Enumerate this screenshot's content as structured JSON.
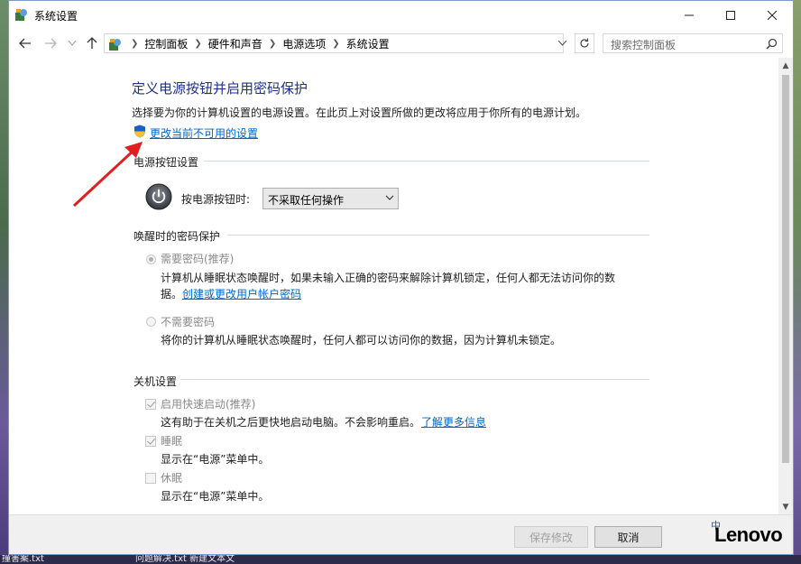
{
  "window": {
    "title": "系统设置"
  },
  "nav": {
    "breadcrumbs": [
      "控制面板",
      "硬件和声音",
      "电源选项",
      "系统设置"
    ],
    "search_placeholder": "搜索控制面板"
  },
  "page": {
    "title": "定义电源按钮并启用密码保护",
    "description": "选择要为你的计算机设置的电源设置。在此页上对设置所做的更改将应用于你所有的电源计划。",
    "change_link": "更改当前不可用的设置"
  },
  "power_button": {
    "section_title": "电源按钮设置",
    "label": "按电源按钮时:",
    "selected": "不采取任何操作"
  },
  "wake_password": {
    "section_title": "唤醒时的密码保护",
    "require": {
      "label": "需要密码(推荐)",
      "desc_line1": "计算机从睡眠状态唤醒时，如果未输入正确的密码来解除计算机锁定，任何人都无法访问你的数",
      "desc_line2_prefix": "据。",
      "link": "创建或更改用户帐户密码",
      "checked": true
    },
    "no_require": {
      "label": "不需要密码",
      "desc": "将你的计算机从睡眠状态唤醒时，任何人都可以访问你的数据，因为计算机未锁定。",
      "checked": false
    }
  },
  "shutdown": {
    "section_title": "关机设置",
    "fast_startup": {
      "label": "启用快速启动(推荐)",
      "desc": "这有助于在关机之后更快地启动电脑。不会影响重启。",
      "link": "了解更多信息",
      "checked": true
    },
    "sleep": {
      "label": "睡眠",
      "desc": "显示在“电源”菜单中。",
      "checked": true
    },
    "hibernate": {
      "label": "休眠",
      "desc": "显示在“电源”菜单中。",
      "checked": false
    }
  },
  "footer": {
    "save": "保存修改",
    "cancel": "取消"
  },
  "desktop": {
    "taskbar_left": "撞害案.txt",
    "taskbar_mid": "问题解决.txt    新建文本文",
    "tray_text": "中",
    "brand": "Lenovo"
  },
  "colors": {
    "title": "#1e3287",
    "link": "#0066cc",
    "arrow": "#e02020"
  }
}
